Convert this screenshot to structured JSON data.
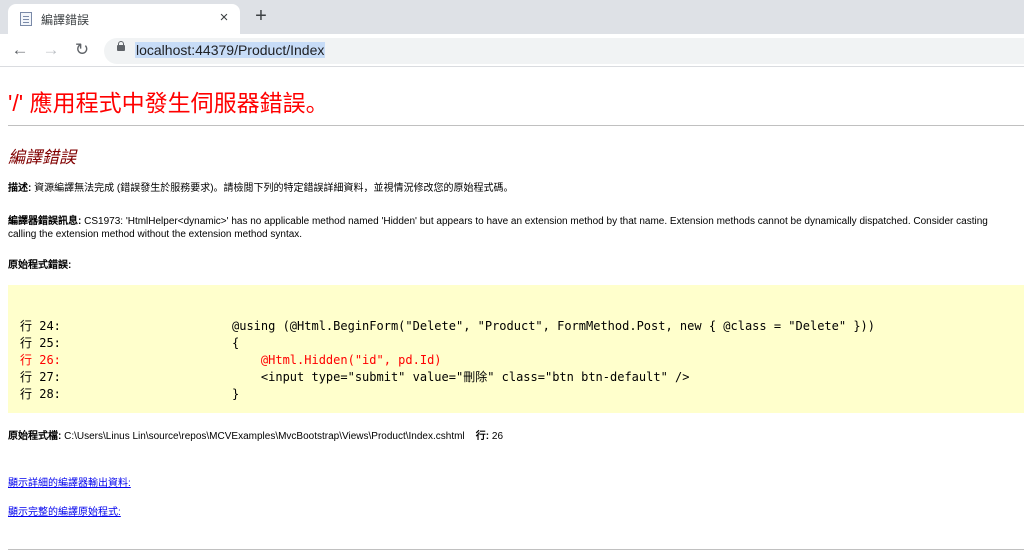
{
  "browser": {
    "tab_title": "編譯錯誤",
    "tab_close": "×",
    "new_tab": "+",
    "url": "localhost:44379/Product/Index",
    "back": "←",
    "forward": "→",
    "reload": "↻"
  },
  "page": {
    "heading": "'/' 應用程式中發生伺服器錯誤。",
    "subheading": "編譯錯誤",
    "description_label": "描述:",
    "description_text": " 資源編譯無法完成 (錯誤發生於服務要求)。請檢閱下列的特定錯誤詳細資料，並視情況修改您的原始程式碼。",
    "compiler_label": "編譯器錯誤訊息:",
    "compiler_text_1": " CS1973: 'HtmlHelper<dynamic>' has no applicable method named 'Hidden' but appears to have an extension method by that name. Extension methods cannot be dynamically dispatched. Consider casting",
    "compiler_text_2": "calling the extension method without the extension method syntax.",
    "source_error_label": "原始程式錯誤:",
    "code_lines": [
      {
        "no": "行 24:",
        "code": "@using (@Html.BeginForm(\"Delete\", \"Product\", FormMethod.Post, new { @class = \"Delete\" }))",
        "error": false
      },
      {
        "no": "行 25:",
        "code": "{",
        "error": false
      },
      {
        "no": "行 26:",
        "code": "    @Html.Hidden(\"id\", pd.Id)",
        "error": true
      },
      {
        "no": "行 27:",
        "code": "    <input type=\"submit\" value=\"刪除\" class=\"btn btn-default\" />",
        "error": false
      },
      {
        "no": "行 28:",
        "code": "}",
        "error": false
      }
    ],
    "source_file_label": "原始程式檔:",
    "source_file_path": " C:\\Users\\Linus Lin\\source\\repos\\MCVExamples\\MvcBootstrap\\Views\\Product\\Index.cshtml",
    "line_label": "行:",
    "line_value": " 26",
    "link_compiler_output": "顯示詳細的編譯器輸出資料:",
    "link_full_source": "顯示完整的編譯原始程式:"
  }
}
